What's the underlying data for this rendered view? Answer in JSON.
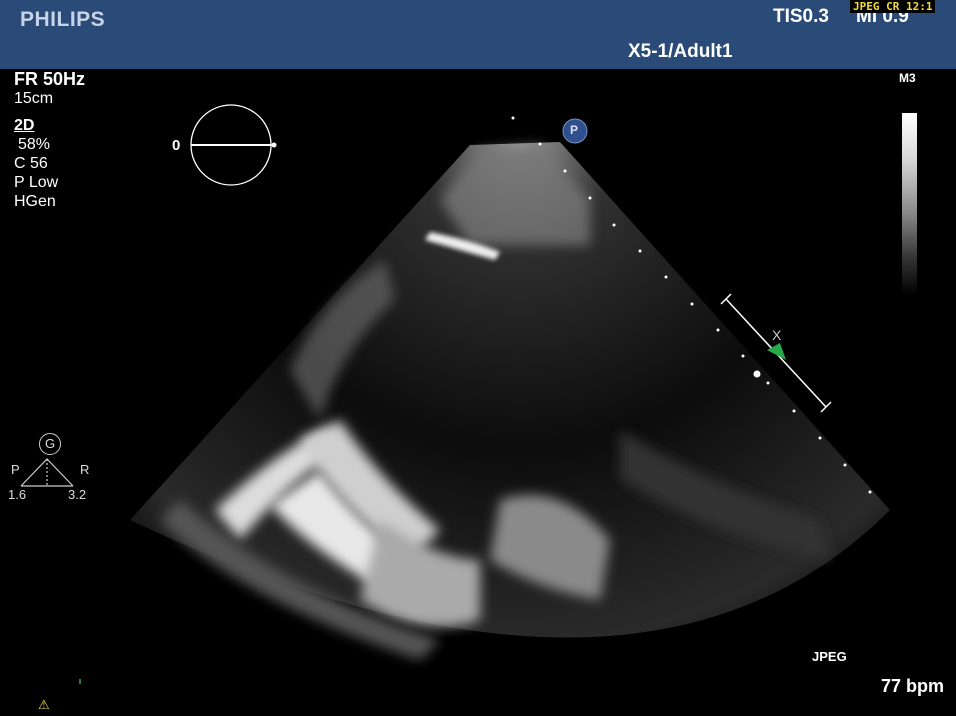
{
  "header": {
    "brand": "PHILIPS",
    "tis": "TIS0.3",
    "mi": "MI 0.9",
    "compression_badge": "JPEG CR 12:1",
    "probe_preset": "X5-1/Adult1",
    "background_color": "#2a4a78"
  },
  "acquisition": {
    "frame_rate": "FR 50Hz",
    "depth": "15cm",
    "mode": "2D",
    "gain": "58%",
    "compression": "C 56",
    "power": "P Low",
    "frequency": "HGen"
  },
  "angle_indicator": {
    "label": "0"
  },
  "colormap": {
    "label": "M3"
  },
  "orientation_marker": {
    "label": "P"
  },
  "focus_marker": {
    "label": "X"
  },
  "body_marker": {
    "g_label": "G",
    "left_label": "P",
    "right_label": "R",
    "left_value": "1.6",
    "right_value": "3.2"
  },
  "footer": {
    "format": "JPEG",
    "heart_rate": "77 bpm",
    "warning_icon": "warning-triangle-icon"
  },
  "colors": {
    "accent_yellow": "#f4dc3c",
    "marker_blue": "#2f4f8f",
    "focus_green": "#2aa84a"
  }
}
